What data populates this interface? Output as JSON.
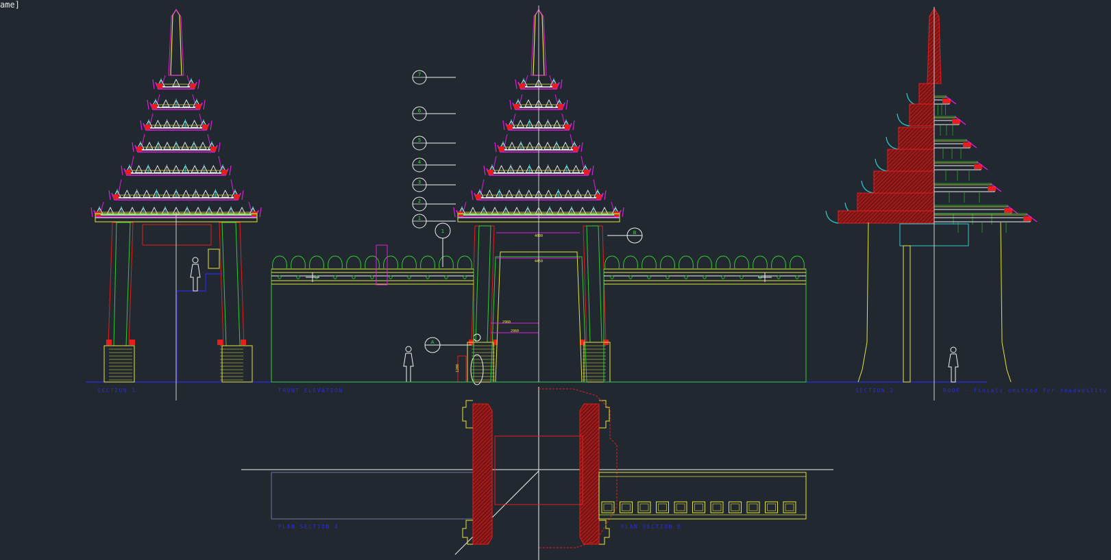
{
  "viewport": {
    "label": "ame]"
  },
  "captions": {
    "section_1": "SECTION 1",
    "front_elevation": "FRONT ELEVATION",
    "section_2": "SECTION 2",
    "roof_note": "ROOF - finials omitted for readability",
    "plan_section_a": "PLAN SECTION A",
    "plan_section_b": "PLAN SECTION B"
  },
  "level_markers": [
    "7",
    "6",
    "5",
    "4",
    "3",
    "2",
    "1"
  ],
  "section_markers": {
    "top": "1",
    "right": "B",
    "left": "A"
  },
  "dimensions": [
    "4000",
    "4450",
    "2960",
    "2960",
    "1200"
  ],
  "colors": {
    "background": "#212830",
    "magenta": "#e01ee0",
    "yellow": "#e6e63a",
    "green": "#33cc33",
    "red": "#e61e1e",
    "cyan": "#2ecccc",
    "white": "#f2f2f2",
    "blue": "#2a2ae6",
    "hatch": "#a01e1e"
  }
}
